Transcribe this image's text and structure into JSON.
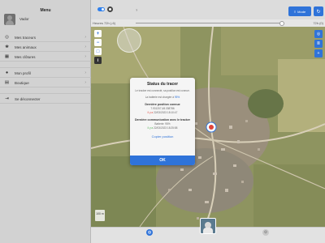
{
  "status_bar": {
    "time": "9:58 PM",
    "date": "Sat 13 Mar",
    "battery": "100%"
  },
  "sidebar": {
    "title": "Menu",
    "profile_name": "Vador",
    "items": [
      {
        "label": "Mes traceurs",
        "icon": "tracker-icon"
      },
      {
        "label": "Mes animaux",
        "icon": "paw-icon"
      },
      {
        "label": "Mes clôtures",
        "icon": "fence-icon"
      },
      {
        "label": "Mon profil",
        "icon": "person-icon"
      },
      {
        "label": "Boutique",
        "icon": "cart-icon"
      },
      {
        "label": "Se déconnecter",
        "icon": "logout-icon"
      }
    ]
  },
  "topbar": {
    "help": "?",
    "mode_label": "Mode",
    "time_start": "Heures",
    "time_left": "72h (-6)",
    "time_right": "72h (0)"
  },
  "map": {
    "scale_label": "100 m"
  },
  "dialog": {
    "title": "Status du tracer",
    "intro": "Le tracker est connecté, sa position est connue.",
    "battery_prefix": "La batterie est chargée à",
    "battery_pct": "95%",
    "last_position_title": "Dernière position connue",
    "last_position_coords": "7.931207,48.338786",
    "last_position_status": "il y a",
    "last_position_time": "22/03/2023 18:10:47",
    "last_comm_title": "Dernière communication avec le tracker",
    "last_comm_battery": "Batterie: 95%",
    "last_comm_status": "il y a",
    "last_comm_time": "22/03/2023 18:25:58",
    "copy_label": "Copier position",
    "ok_label": "OK"
  },
  "tabbar": {
    "tabs": [
      {
        "label": "",
        "icon": "globe-icon"
      },
      {
        "label": "",
        "icon": "gear-icon"
      }
    ]
  },
  "colors": {
    "accent": "#2f73d9",
    "status_red": "#e0453b",
    "status_green": "#4caf50"
  }
}
